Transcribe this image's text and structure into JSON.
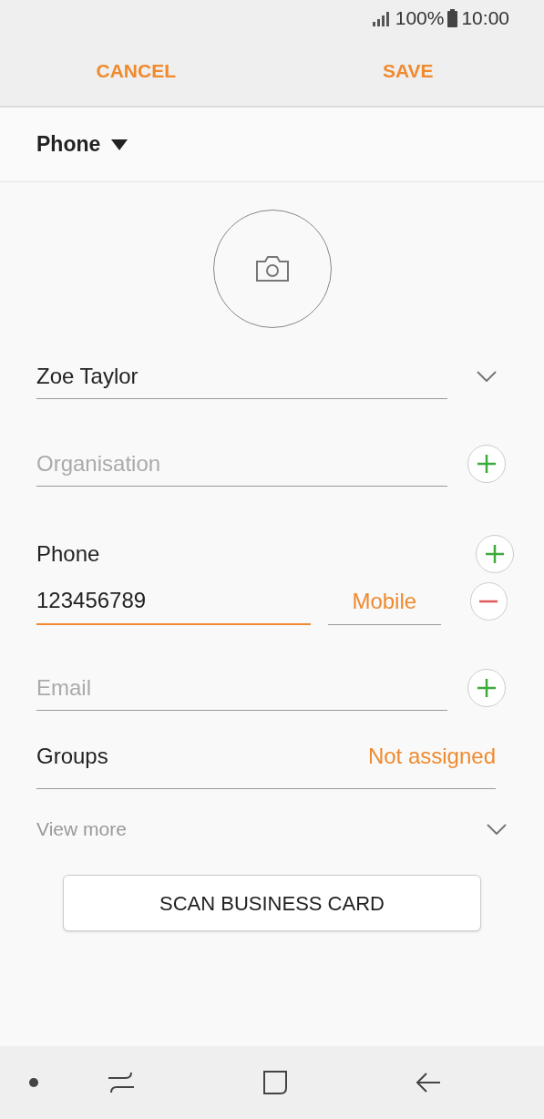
{
  "status_bar": {
    "battery": "100%",
    "time": "10:00"
  },
  "header": {
    "cancel": "CANCEL",
    "save": "SAVE"
  },
  "account": {
    "label": "Phone"
  },
  "name_field": {
    "value": "Zoe Taylor"
  },
  "organisation_field": {
    "placeholder": "Organisation"
  },
  "phone": {
    "label": "Phone",
    "value": "123456789",
    "focused": true,
    "type": "Mobile"
  },
  "email_field": {
    "placeholder": "Email"
  },
  "groups": {
    "label": "Groups",
    "value": "Not assigned"
  },
  "view_more": "View more",
  "scan_button": "SCAN BUSINESS CARD"
}
